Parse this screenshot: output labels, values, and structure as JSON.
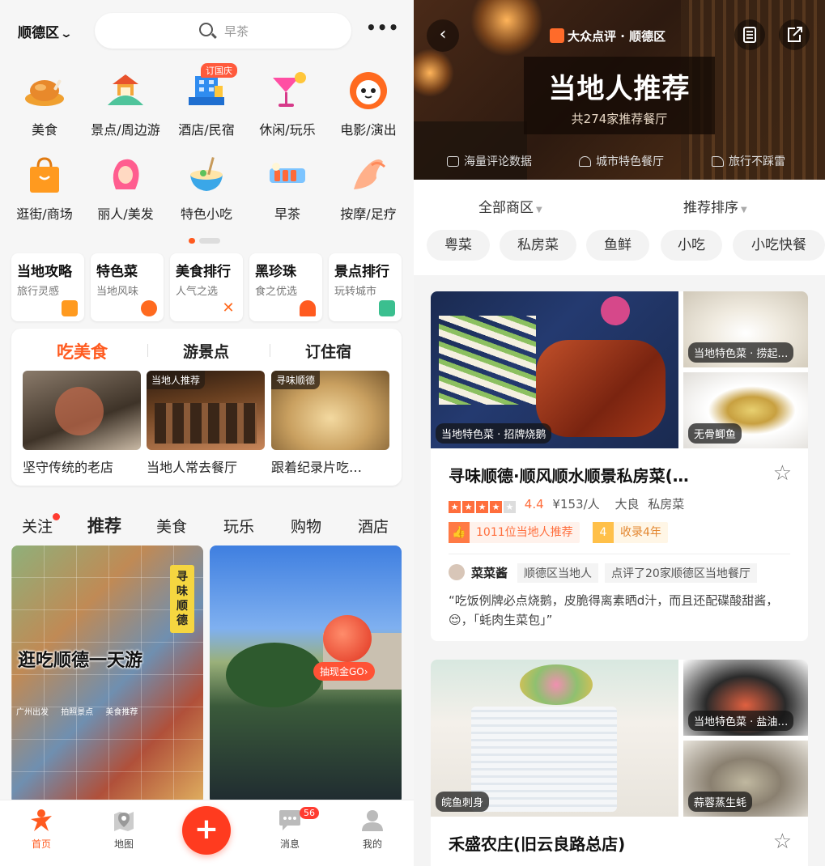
{
  "left": {
    "header": {
      "city": "顺德区",
      "search_placeholder": "早茶",
      "more": "•••"
    },
    "categories_row1": [
      {
        "label": "美食",
        "icon": "roast-chicken-icon"
      },
      {
        "label": "景点/周边游",
        "icon": "pavilion-icon"
      },
      {
        "label": "酒店/民宿",
        "icon": "hotel-building-icon",
        "badge": "订国庆"
      },
      {
        "label": "休闲/玩乐",
        "icon": "cocktail-icon"
      },
      {
        "label": "电影/演出",
        "icon": "cat-mascot-icon"
      }
    ],
    "categories_row2": [
      {
        "label": "逛街/商场",
        "icon": "shopping-bag-icon"
      },
      {
        "label": "丽人/美发",
        "icon": "hair-beauty-icon"
      },
      {
        "label": "特色小吃",
        "icon": "noodle-bowl-icon"
      },
      {
        "label": "早茶",
        "icon": "dim-sum-icon"
      },
      {
        "label": "按摩/足疗",
        "icon": "massage-hand-icon"
      }
    ],
    "mini_cards": [
      {
        "title": "当地攻略",
        "sub": "旅行灵感"
      },
      {
        "title": "特色菜",
        "sub": "当地风味"
      },
      {
        "title": "美食排行",
        "sub": "人气之选"
      },
      {
        "title": "黑珍珠",
        "sub": "食之优选"
      },
      {
        "title": "景点排行",
        "sub": "玩转城市"
      }
    ],
    "food_card": {
      "tabs": [
        "吃美食",
        "游景点",
        "订住宿"
      ],
      "items": [
        {
          "tag": "",
          "caption": "坚守传统的老店"
        },
        {
          "tag": "当地人推荐",
          "caption": "当地人常去餐厅"
        },
        {
          "tag": "寻味顺德",
          "caption": "跟着纪录片吃…"
        }
      ]
    },
    "feed_tabs": [
      "关注",
      "推荐",
      "美食",
      "玩乐",
      "购物",
      "酒店"
    ],
    "feed": {
      "card1_title": "逛吃顺德一天游",
      "card1_vertical": "寻味顺德",
      "card1_chips": [
        "广州出发",
        "拍照景点",
        "美食推荐"
      ],
      "card2_cash": "抽现金GO›"
    },
    "bottom_nav": [
      {
        "label": "首页",
        "icon": "home-person-icon"
      },
      {
        "label": "地图",
        "icon": "map-pin-icon"
      },
      {
        "label": "消息",
        "icon": "chat-bubble-icon",
        "badge": "56"
      },
      {
        "label": "我的",
        "icon": "user-icon"
      }
    ],
    "accent": "#ff5a1f"
  },
  "right": {
    "hero": {
      "brand": "大众点评 · 顺德区",
      "title": "当地人推荐",
      "subtitle": "共274家推荐餐厅",
      "features": [
        "海量评论数据",
        "城市特色餐厅",
        "旅行不踩雷"
      ]
    },
    "sort": {
      "area": "全部商区",
      "order": "推荐排序"
    },
    "cuisines": [
      "粤菜",
      "私房菜",
      "鱼鲜",
      "小吃",
      "小吃快餐"
    ],
    "restaurants": [
      {
        "name": "寻味顺德·顺风顺水顺景私房菜(…",
        "rating": "4.4",
        "stars": 4,
        "price": "¥153/人",
        "area": "大良",
        "cuisine": "私房菜",
        "local_tag": "1011位当地人推荐",
        "years_icon": "4",
        "years_tag": "收录4年",
        "img_labels": [
          "当地特色菜 · 招牌烧鹅",
          "当地特色菜 · 捞起…",
          "无骨鲫鱼"
        ],
        "reviewer": "菜菜酱",
        "reviewer_tags": [
          "顺德区当地人",
          "点评了20家顺德区当地餐厅"
        ],
        "quote": "“吃饭例牌必点烧鹅，皮脆得离素晒d汁，而且还配碟酸甜酱，😌，「蚝肉生菜包」”"
      },
      {
        "name": "禾盛农庄(旧云良路总店)",
        "img_labels": [
          "皖鱼刺身",
          "当地特色菜 · 盐油…",
          "蒜蓉蒸生蚝"
        ]
      }
    ]
  }
}
